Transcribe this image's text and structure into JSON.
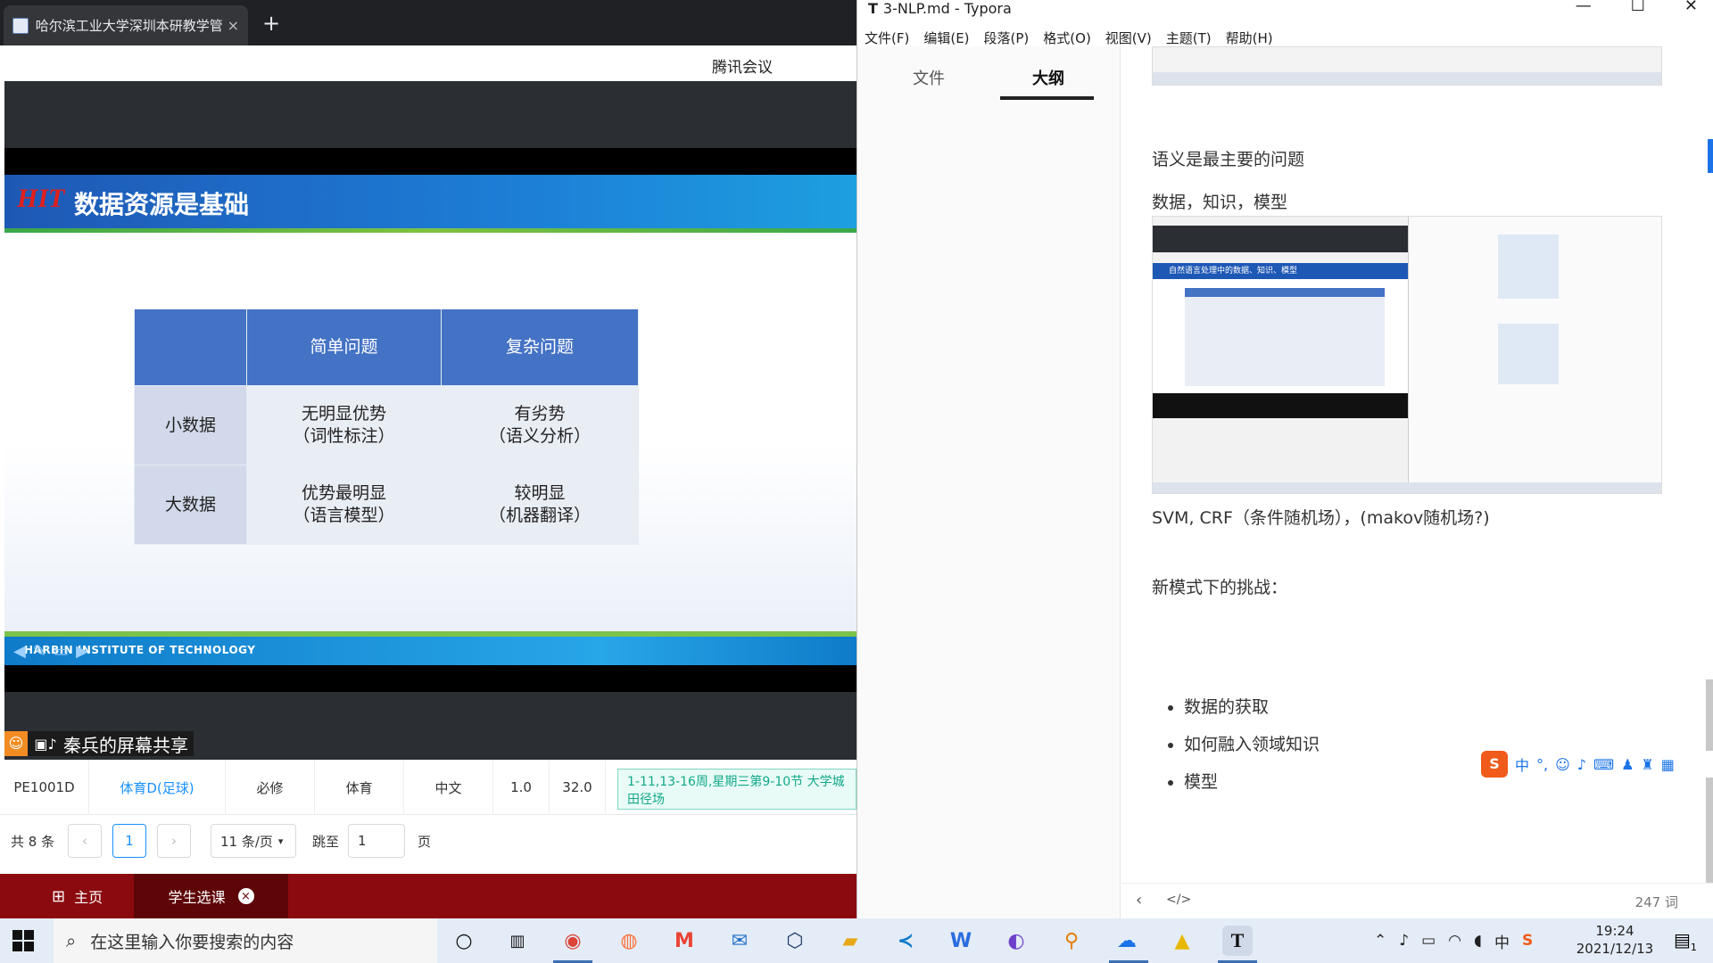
{
  "browser": {
    "tab_title": "哈尔滨工业大学深圳本研教学管",
    "tab_close": "×",
    "new_tab": "+",
    "meeting_title": "腾讯会议"
  },
  "slide": {
    "logo": "HIT",
    "title": "数据资源是基础",
    "table": {
      "headers": [
        "",
        "简单问题",
        "复杂问题"
      ],
      "rows": [
        {
          "label": "小数据",
          "simple_1": "无明显优势",
          "simple_2": "（词性标注）",
          "complex_1": "有劣势",
          "complex_2": "（语义分析）"
        },
        {
          "label": "大数据",
          "simple_1": "优势最明显",
          "simple_2": "（语言模型）",
          "complex_1": "较明显",
          "complex_2": "（机器翻译）"
        }
      ]
    },
    "footer_text": "HARBIN INSTITUTE OF TECHNOLOGY",
    "sharer_text": "秦兵的屏幕共享"
  },
  "course_row": {
    "code": "PE1001D",
    "name": "体育D(足球)",
    "type": "必修",
    "category": "体育",
    "language": "中文",
    "credits": "1.0",
    "hours": "32.0",
    "time_place": "1-11,13-16周,星期三第9-10节 大学城田径场"
  },
  "pager": {
    "total": "共 8 条",
    "prev": "‹",
    "page": "1",
    "next": "›",
    "page_size": "11 条/页",
    "jump_label": "跳至",
    "jump_value": "1",
    "page_unit": "页"
  },
  "sys_nav": {
    "home": "主页",
    "course_select": "学生选课",
    "close": "×"
  },
  "typora": {
    "window_title": "3-NLP.md - Typora",
    "win_min": "—",
    "win_max": "☐",
    "win_close": "✕",
    "menu": [
      "文件(F)",
      "编辑(E)",
      "段落(P)",
      "格式(O)",
      "视图(V)",
      "主题(T)",
      "帮助(H)"
    ],
    "sidebar_tabs": [
      "文件",
      "大纲"
    ],
    "line1": "语义是最主要的问题",
    "line2": "数据，知识，模型",
    "line3": "SVM, CRF（条件随机场），(makov随机场?)",
    "line4": "新模式下的挑战：",
    "bullets": [
      "数据的获取",
      "如何融入领域知识",
      "模型"
    ],
    "word_count": "247 词",
    "nested_slide_title": "自然语言处理中的数据、知识、模型"
  },
  "ime": {
    "logo": "S",
    "mode": "中",
    "punct": "°,"
  },
  "taskbar": {
    "search_placeholder": "在这里输入你要搜索的内容",
    "time": "19:24",
    "date": "2021/12/13",
    "ime_lang": "中",
    "notif_count": "1",
    "typora_letter": "T"
  },
  "colors": {
    "slide_header": "#1e58b5",
    "table_head": "#4472c4",
    "nav_bar": "#8b0a0f",
    "link": "#1890ff",
    "time_chip": "#13a889"
  }
}
